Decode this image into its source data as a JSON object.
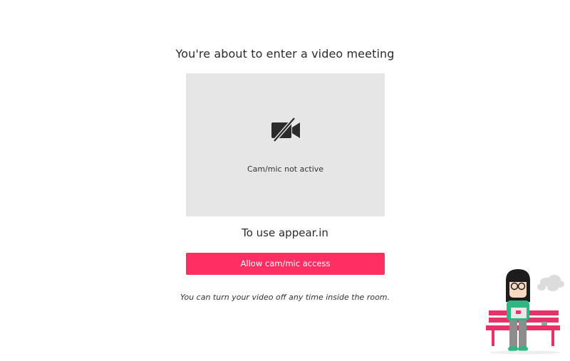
{
  "page": {
    "heading": "You're about to enter a video meeting",
    "subheading": "To use appear.in",
    "note": "You can turn your video off any time inside the room."
  },
  "preview": {
    "status": "Cam/mic not active",
    "icon": "camera-off-icon"
  },
  "actions": {
    "allow_label": "Allow cam/mic access"
  },
  "colors": {
    "accent": "#ff2e63",
    "preview_bg": "#e6e6e6",
    "text": "#2b2b2b"
  }
}
